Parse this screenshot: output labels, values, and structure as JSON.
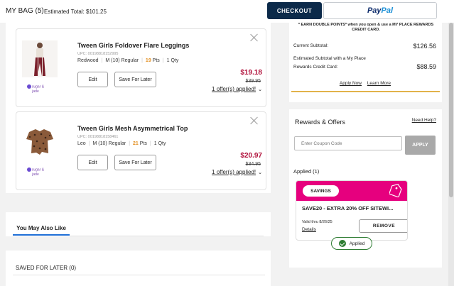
{
  "header": {
    "bag_title": "MY BAG (5)",
    "estimated_total": "Estimated Total: $101.25",
    "checkout_label": "CHECKOUT",
    "paypal_pay": "Pay",
    "paypal_pal": "Pal"
  },
  "items": [
    {
      "name": "Tween Girls Foldover Flare Leggings",
      "upc": "UPC: 00198818152995",
      "color": "Redwood",
      "size": "M (10) Regular",
      "points_value": "19",
      "points_unit": "Pts",
      "qty": "1 Qty",
      "edit_label": "Edit",
      "save_label": "Save For Later",
      "sale_price": "$19.18",
      "original_price": "$39.95",
      "offers": "1 offer(s) applied!"
    },
    {
      "name": "Tween Girls Mesh Asymmetrical Top",
      "upc": "UPC: 00198818158461",
      "color": "Leo",
      "size": "M (10) Regular",
      "points_value": "21",
      "points_unit": "Pts",
      "qty": "1 Qty",
      "edit_label": "Edit",
      "save_label": "Save For Later",
      "sale_price": "$20.97",
      "original_price": "$34.95",
      "offers": "1 offer(s) applied!"
    }
  ],
  "brand_logo_text": "sugar & jade",
  "ymal_tab": "You May Also Like",
  "saved_for_later": "SAVED FOR LATER (0)",
  "summary": {
    "top_note": "* EARN DOUBLE POINTS* when you open & use a MY PLACE REWARDS CREDIT CARD.",
    "current_subtotal_label": "Current Subtotal:",
    "current_subtotal_value": "$126.56",
    "estimated_label_1": "Estimated Subtotal with a My Place",
    "estimated_label_2": "Rewards Credit Card:",
    "estimated_value": "$88.59",
    "apply_now": "Apply Now",
    "learn_more": "Learn More",
    "accent_color": "#e2b24a"
  },
  "rewards": {
    "title": "Rewards & Offers",
    "need_help": "Need Help?",
    "coupon_placeholder": "Enter Coupon Code",
    "apply_label": "APPLY",
    "applied_count": "Applied (1)",
    "coupon": {
      "badge": "SAVINGS",
      "code": "SAVE20 - EXTRA 20% OFF SITEWI...",
      "valid_thru": "Valid thru 8/26/25",
      "details": "Details",
      "remove": "REMOVE",
      "applied": "Applied",
      "head_color": "#e6007e"
    }
  },
  "icons": {
    "close": "close-icon",
    "chevron": "chevron-down-icon",
    "tag": "tag-icon",
    "check": "check-circle-icon"
  }
}
